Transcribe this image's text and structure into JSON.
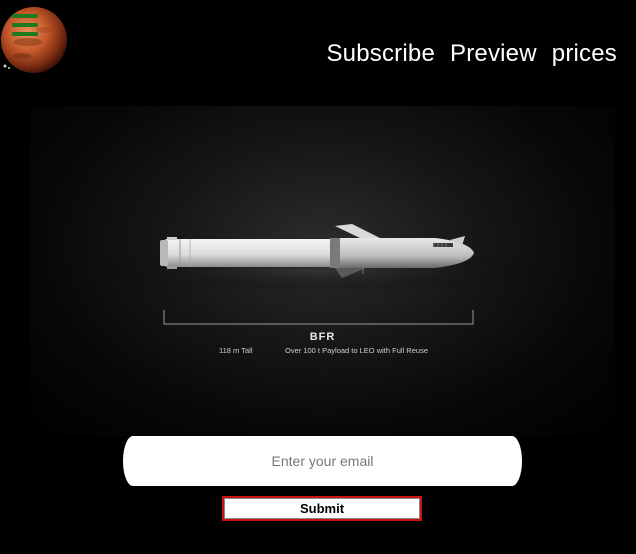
{
  "header": {
    "logo_icon": "mars-planet-icon",
    "menu_icon": "hamburger-menu-icon",
    "nav": [
      {
        "label": "Subscribe"
      },
      {
        "label": "Preview"
      },
      {
        "label": "prices"
      }
    ]
  },
  "hero": {
    "image": "bfr-rocket-image",
    "title": "BFR",
    "spec_height": "118 m Tall",
    "spec_payload": "Over 100 t Payload to LEO with Full Reuse"
  },
  "form": {
    "email_placeholder": "Enter your email",
    "email_value": "",
    "submit_label": "Submit"
  },
  "colors": {
    "background": "#000000",
    "menu_icon": "#1f7a1f",
    "submit_border": "#cc1111"
  }
}
